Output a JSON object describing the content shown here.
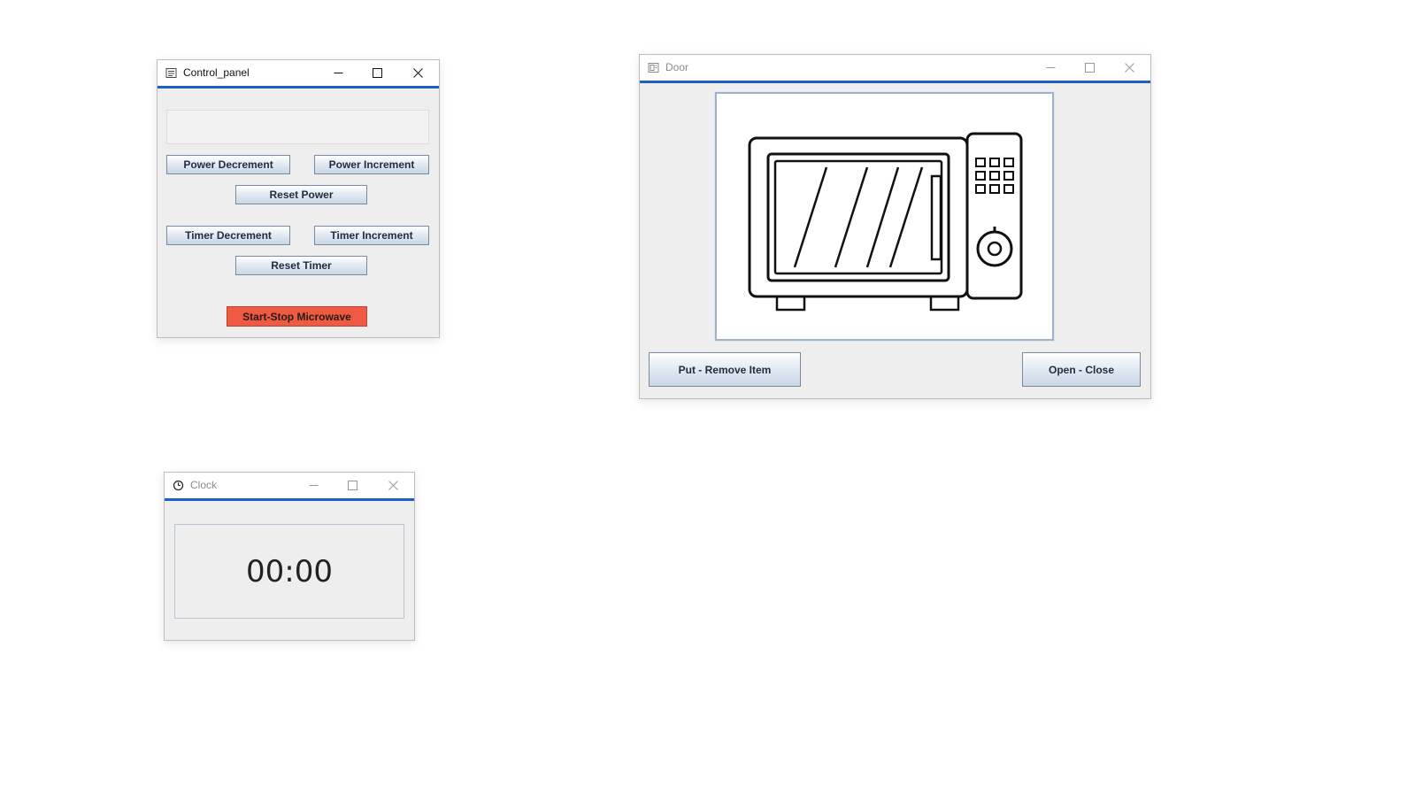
{
  "control_panel": {
    "title": "Control_panel",
    "display_value": "",
    "buttons": {
      "power_decrement": "Power Decrement",
      "power_increment": "Power Increment",
      "reset_power": "Reset Power",
      "timer_decrement": "Timer Decrement",
      "timer_increment": "Timer Increment",
      "reset_timer": "Reset Timer",
      "start_stop": "Start-Stop Microwave"
    },
    "start_stop_color": "#ee5a43"
  },
  "door": {
    "title": "Door",
    "image_icon": "microwave-icon",
    "buttons": {
      "put_remove": "Put - Remove Item",
      "open_close": "Open - Close"
    }
  },
  "clock": {
    "title": "Clock",
    "time": "00:00"
  },
  "colors": {
    "titlebar_accent": "#1d5fc8",
    "window_bg": "#eeeeee"
  }
}
